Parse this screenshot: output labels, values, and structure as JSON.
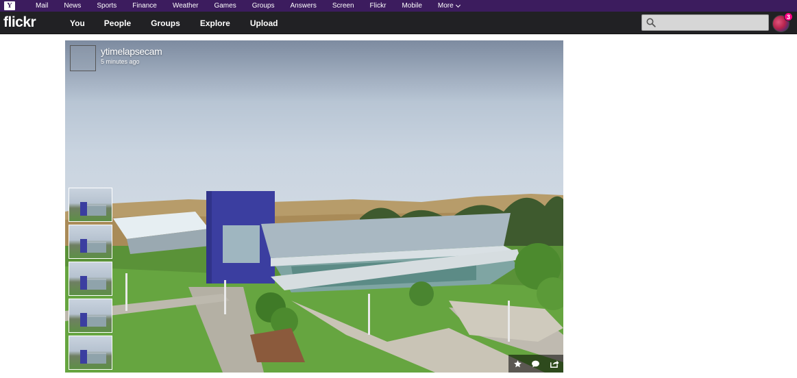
{
  "yahoo_bar": {
    "logo": "Y",
    "links": [
      "Mail",
      "News",
      "Sports",
      "Finance",
      "Weather",
      "Games",
      "Groups",
      "Answers",
      "Screen",
      "Flickr",
      "Mobile"
    ],
    "more_label": "More"
  },
  "flickr_bar": {
    "logo": "flickr",
    "nav": [
      "You",
      "People",
      "Groups",
      "Explore",
      "Upload"
    ],
    "search_placeholder": "",
    "notification_count": "3"
  },
  "photo": {
    "owner": "ytimelapsecam",
    "posted": "5 minutes ago",
    "thumbnail_count": 5
  },
  "colors": {
    "yahoo_purple": "#3c1c5e",
    "flickr_bar": "#212124",
    "building_blue": "#3b3ea0",
    "notification_pink": "#ff0084"
  },
  "icons": [
    "yahoo-logo",
    "search-icon",
    "chevron-down-icon",
    "star-icon",
    "comment-icon",
    "share-icon"
  ]
}
